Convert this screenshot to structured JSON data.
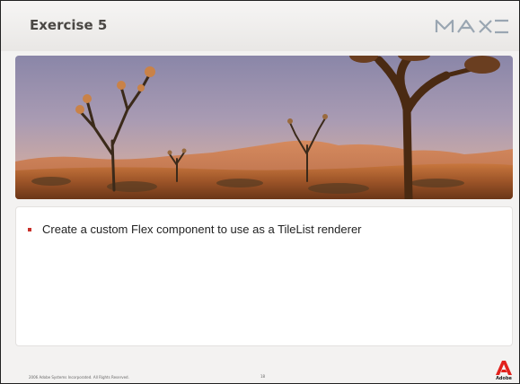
{
  "slide": {
    "title": "Exercise 5",
    "logo_text": "MAX",
    "photo_alt": "desert-joshua-trees-photo",
    "bullets": [
      "Create a custom Flex component to use as a TileList renderer"
    ],
    "footer": {
      "copyright": "2006 Adobe Systems Incorporated. All Rights Reserved.",
      "page_number": "18",
      "brand": "Adobe"
    }
  },
  "colors": {
    "bullet": "#c8302a",
    "title": "#4a4744",
    "background": "#f3f2f1",
    "adobe_red": "#e2211c"
  }
}
